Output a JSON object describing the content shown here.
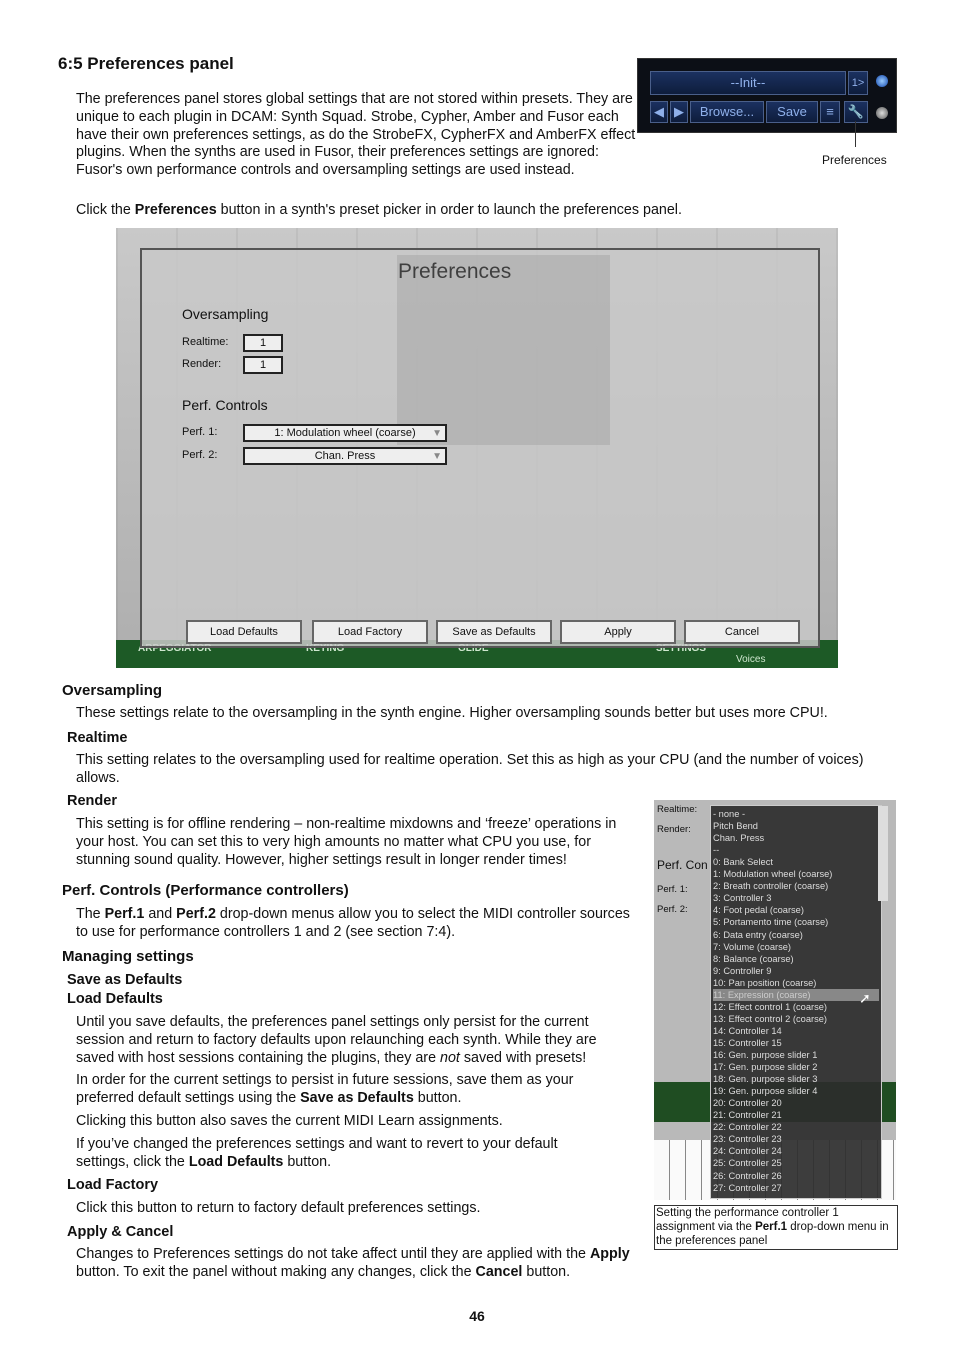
{
  "section_title": "6:5 Preferences panel",
  "intro": "The preferences panel stores global settings that are not stored within presets. They are unique to each plugin in DCAM: Synth Squad. Strobe, Cypher, Amber and Fusor each have their own preferences settings, as do the StrobeFX, CypherFX and AmberFX effect plugins. When the synths are used in Fusor, their preferences settings are ignored: Fusor's own performance controls and oversampling settings are used instead.",
  "click_pre": "Click the ",
  "click_bold": "Preferences",
  "click_post": " button in a synth's preset picker in order to launch the preferences panel.",
  "picker": {
    "preset": "--Init--",
    "prog": "1>",
    "browse": "Browse...",
    "save": "Save",
    "caption": "Preferences"
  },
  "dialog": {
    "title": "Preferences",
    "oversampling": "Oversampling",
    "realtime_label": "Realtime:",
    "realtime": "1",
    "render_label": "Render:",
    "render": "1",
    "perf_controls": "Perf. Controls",
    "perf1_label": "Perf. 1:",
    "perf1": "1: Modulation wheel (coarse)",
    "perf2_label": "Perf. 2:",
    "perf2": "Chan. Press",
    "buttons": [
      "Load Defaults",
      "Load Factory",
      "Save as Defaults",
      "Apply",
      "Cancel"
    ],
    "strip": [
      "ARPEGGIATOR",
      "KEYING",
      "GLIDE",
      "SETTINGS",
      "Voices"
    ]
  },
  "sections": {
    "oversampling_h": "Oversampling",
    "oversampling_p": "These settings relate to the oversampling in the synth engine. Higher oversampling sounds better but uses more CPU!.",
    "realtime_h": "Realtime",
    "realtime_p": "This setting relates to the oversampling used for realtime operation. Set this as high as your CPU (and the number of voices) allows.",
    "render_h": "Render",
    "render_p": "This setting is for offline rendering – non-realtime mixdowns and ‘freeze’ operations in your host. You can set this to very high amounts no matter what CPU you use, for stunning sound quality. However, higher settings result in longer render times!",
    "perf_h": "Perf. Controls (Performance controllers)",
    "perf_p1": "The ",
    "perf_b1": "Perf.1",
    "perf_p2": " and ",
    "perf_b2": "Perf.2",
    "perf_p3": " drop-down menus allow you to select the MIDI controller sources to use for performance controllers 1 and 2 (see section 7:4).",
    "managing_h": "Managing settings",
    "save_h": "Save as Defaults",
    "load_h": "Load Defaults",
    "load_p1": "Until you save defaults, the preferences panel settings only persist for the current session and return to factory defaults upon relaunching each synth. While they are saved with host sessions containing the plugins, they are ",
    "load_p1_i": "not",
    "load_p1_end": " saved with presets!",
    "load_p2": "In order for the current settings to persist in future sessions, save them as your preferred default settings using the ",
    "load_p2_b": "Save as Defaults",
    "load_p2_end": " button.",
    "load_p3": "Clicking this button also saves the current MIDI Learn assignments.",
    "load_p4": "If you’ve changed the preferences settings and want to revert to your default settings, click the ",
    "load_p4_b": "Load Defaults",
    "load_p4_end": " button.",
    "factory_h": "Load Factory",
    "factory_p": "Click this button to return to factory default preferences settings.",
    "apply_h": "Apply & Cancel",
    "apply_p1": "Changes to Preferences settings do not take affect until they are applied with the ",
    "apply_b1": "Apply",
    "apply_p2": " button. To exit the panel without making any changes, click the ",
    "apply_b2": "Cancel",
    "apply_p3": " button."
  },
  "menu": {
    "labels": [
      "Realtime:",
      "Render:",
      "Perf. Con",
      "Perf. 1:",
      "Perf. 2:"
    ],
    "items": [
      "- none -",
      "Pitch Bend",
      "Chan. Press",
      "--",
      "0: Bank Select",
      "1: Modulation wheel (coarse)",
      "2: Breath controller (coarse)",
      "3: Controller 3",
      "4: Foot pedal (coarse)",
      "5: Portamento time (coarse)",
      "6: Data entry (coarse)",
      "7: Volume (coarse)",
      "8: Balance (coarse)",
      "9: Controller 9",
      "10: Pan position (coarse)",
      "11: Expression (coarse)",
      "12: Effect control 1 (coarse)",
      "13: Effect control 2 (coarse)",
      "14: Controller 14",
      "15: Controller 15",
      "16: Gen. purpose slider 1",
      "17: Gen. purpose slider 2",
      "18: Gen. purpose slider 3",
      "19: Gen. purpose slider 4",
      "20: Controller 20",
      "21: Controller 21",
      "22: Controller 22",
      "23: Controller 23",
      "24: Controller 24",
      "25: Controller 25",
      "26: Controller 26",
      "27: Controller 27"
    ],
    "selected_index": 15
  },
  "caption2_pre": "Setting the performance controller 1 assignment via the ",
  "caption2_b": "Perf.1",
  "caption2_post": " drop-down menu in the preferences panel",
  "page_number": "46"
}
